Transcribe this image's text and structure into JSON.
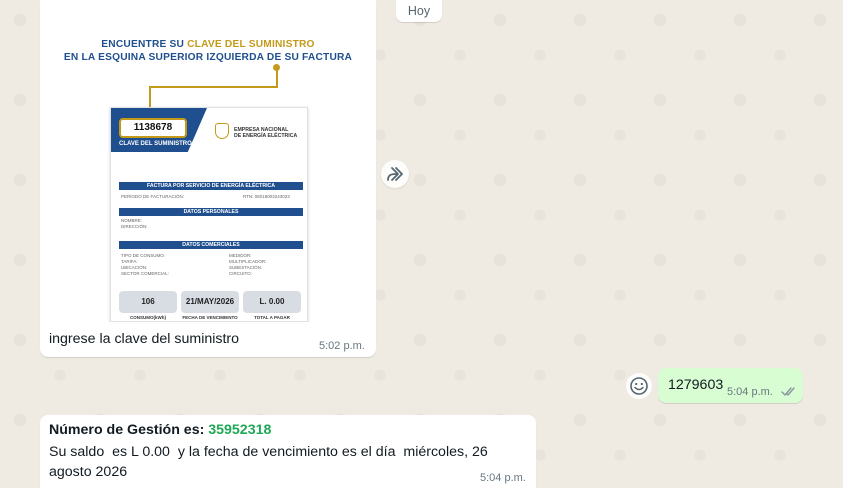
{
  "day_chip": "Hoy",
  "image_message": {
    "heading_line1_pre": "ENCUENTRE SU ",
    "heading_line1_hl": "CLAVE DEL SUMINISTRO",
    "heading_line2": "EN LA ESQUINA SUPERIOR IZQUIERDA DE SU FACTURA",
    "invoice": {
      "code": "1138678",
      "code_label": "CLAVE DEL SUMINISTRO",
      "company_line1": "EMPRESA NACIONAL",
      "company_line2": "DE ENERGÍA ELÉCTRICA",
      "band_title": "FACTURA POR SERVICIO DE ENERGÍA ELÉCTRICA",
      "period_label": "PERÍODO DE FACTURACIÓN:",
      "rtn_label": "RTN: 08019003243023",
      "personal_band": "DATOS PERSONALES",
      "name_label": "NOMBRE:",
      "address_label": "DIRECCIÓN:",
      "commercial_band": "DATOS COMERCIALES",
      "left_fields": "TIPO DE CONSUMO:\nTARIFA:\nUBICACIÓN:\nSECTOR COMERCIAL:",
      "right_fields": "MEDIDOR:\nMULTIPLICADOR:\nSUBESTACIÓN:\nCIRCUITO:",
      "consumption_value": "106",
      "due_date_value": "21/MAY/2026",
      "total_value": "L. 0.00",
      "consumption_label": "CONSUMO(kWh)",
      "due_date_label": "FECHA DE VENCIMIENTO",
      "total_label": "TOTAL A PAGAR"
    },
    "caption": "ingrese la clave del suministro",
    "time": "5:02 p.m."
  },
  "outgoing_message": {
    "text": "1279603",
    "time": "5:04 p.m."
  },
  "reply_message": {
    "label": "Número de Gestión es: ",
    "number": "35952318",
    "body": "Su saldo  es L 0.00  y la fecha de vencimiento es el día  miércoles, 26\nagosto 2026",
    "time": "5:04 p.m."
  },
  "colors": {
    "chat_bg": "#efeae2",
    "incoming_bubble": "#ffffff",
    "outgoing_bubble": "#d9fdd3",
    "read_ticks": "#53bdeb",
    "number_green": "#1fa855",
    "invoice_blue": "#1f4f8f",
    "invoice_gold": "#c49a1a"
  },
  "icons": {
    "forward": "forward-icon",
    "emoji": "emoji-react-icon",
    "ticks": "double-check-icon"
  }
}
